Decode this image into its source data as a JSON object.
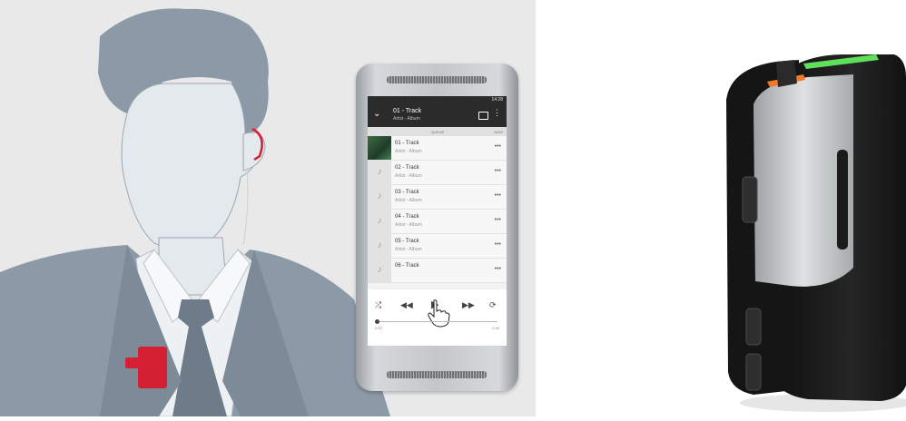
{
  "phone": {
    "status": "14:28",
    "header": {
      "title": "01 - Track",
      "subtitle": "Artist - Album"
    },
    "tabs": [
      "QUEUE",
      "NOW"
    ],
    "tracks": [
      {
        "name": "01 - Track",
        "artist": "Artist - Album"
      },
      {
        "name": "02 - Track",
        "artist": "Artist - Album"
      },
      {
        "name": "03 - Track",
        "artist": "Artist - Album"
      },
      {
        "name": "04 - Track",
        "artist": "Artist - Album"
      },
      {
        "name": "05 - Track",
        "artist": "Artist - Album"
      },
      {
        "name": "06 - Track",
        "artist": ""
      }
    ],
    "time_elapsed": "0:00",
    "time_remaining": "-0:45",
    "progress": 0.0
  },
  "icons": [
    "chevron-down-icon",
    "cast-icon",
    "more-icon",
    "shuffle-icon",
    "rewind-icon",
    "play-icon",
    "fast-forward-icon",
    "repeat-icon",
    "hand-cursor-icon"
  ],
  "colors": {
    "figure": "#8b9aa6",
    "skin": "#e4e9ee",
    "accent": "#d42032",
    "phone_frame": "#c4c7ca",
    "device_body": "#1d1d1d",
    "device_metal": "#b9bcbe",
    "led_green": "#5fe05a",
    "led_orange": "#f07a2a"
  }
}
